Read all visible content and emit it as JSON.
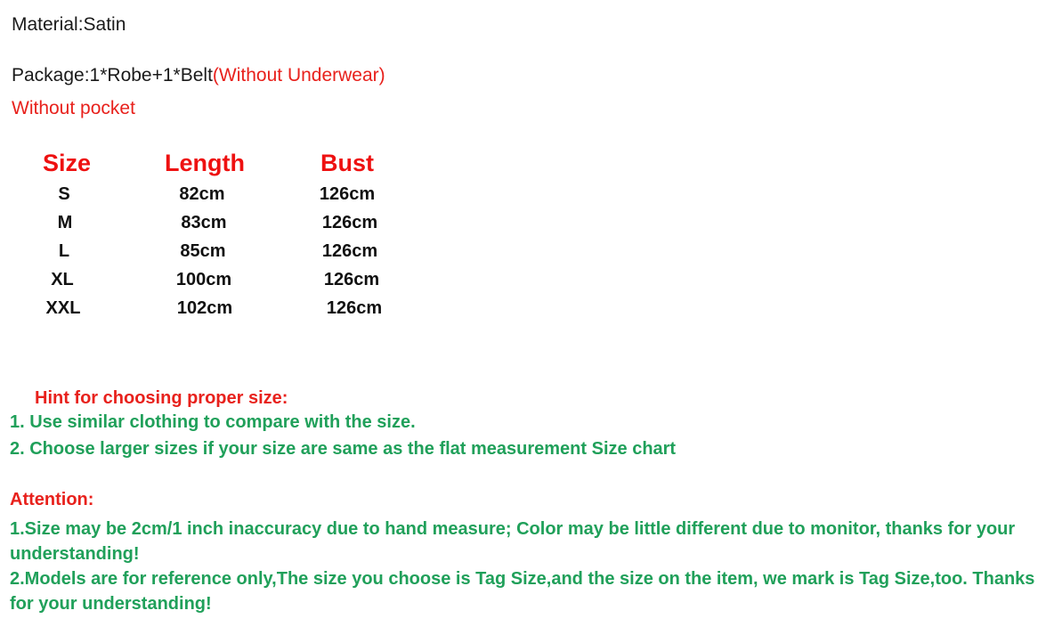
{
  "colors": {
    "red": "#e8211c",
    "header_red": "#ee1111",
    "green": "#20a05a",
    "black": "#111111",
    "background": "#ffffff"
  },
  "intro": {
    "material_line": "Material:Satin",
    "package_label": "Package:1*Robe+1*Belt",
    "package_note": "(Without Underwear)",
    "no_pocket": "Without pocket"
  },
  "size_chart": {
    "headers": [
      "Size",
      "Length",
      "Bust"
    ],
    "rows": [
      {
        "size": "S",
        "length": "82cm",
        "bust": "126cm"
      },
      {
        "size": "M",
        "length": "83cm",
        "bust": "126cm"
      },
      {
        "size": "L",
        "length": "85cm",
        "bust": "126cm"
      },
      {
        "size": "XL",
        "length": "100cm",
        "bust": "126cm"
      },
      {
        "size": "XXL",
        "length": "102cm",
        "bust": "126cm"
      }
    ]
  },
  "hint": {
    "title": "Hint for choosing proper size:",
    "lines": [
      "1. Use similar clothing to compare with the size.",
      "2. Choose larger sizes if your size are same as the flat measurement Size chart"
    ]
  },
  "attention": {
    "title": "Attention:",
    "paragraphs": [
      "1.Size may be 2cm/1 inch inaccuracy due to hand measure; Color may be little different  due to monitor, thanks for your understanding!",
      "2.Models are for reference only,The size you choose is Tag Size,and the size on the item,  we mark is Tag Size,too. Thanks for your understanding!"
    ]
  },
  "chart_data": {
    "type": "table",
    "title": "Size chart",
    "categories": [
      "S",
      "M",
      "L",
      "XL",
      "XXL"
    ],
    "columns": [
      "Size",
      "Length",
      "Bust"
    ],
    "series": [
      {
        "name": "Length",
        "unit": "cm",
        "values": [
          82,
          83,
          85,
          100,
          102
        ]
      },
      {
        "name": "Bust",
        "unit": "cm",
        "values": [
          126,
          126,
          126,
          126,
          126
        ]
      }
    ],
    "xlabel": "Size",
    "ylabel": "",
    "grid": false,
    "legend": "none"
  }
}
